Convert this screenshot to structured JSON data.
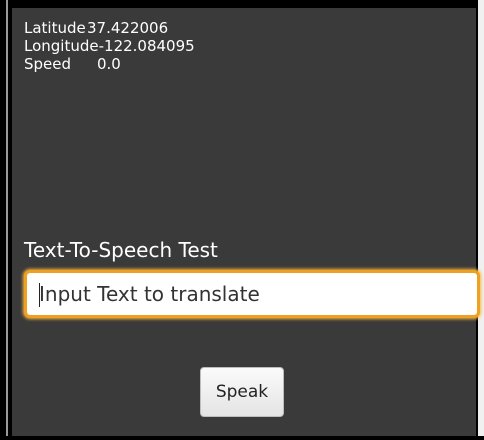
{
  "location": {
    "latitude_label": "Latitude",
    "latitude_value": "37.422006",
    "longitude_label": "Longitude",
    "longitude_value": "-122.084095",
    "speed_label": "Speed",
    "speed_value": "0.0"
  },
  "tts": {
    "title": "Text-To-Speech Test",
    "input_placeholder": "Input Text to translate",
    "input_value": "",
    "speak_label": "Speak"
  },
  "colors": {
    "background": "#3a3a3a",
    "input_focus_border": "#f0a020",
    "text": "#ffffff"
  }
}
